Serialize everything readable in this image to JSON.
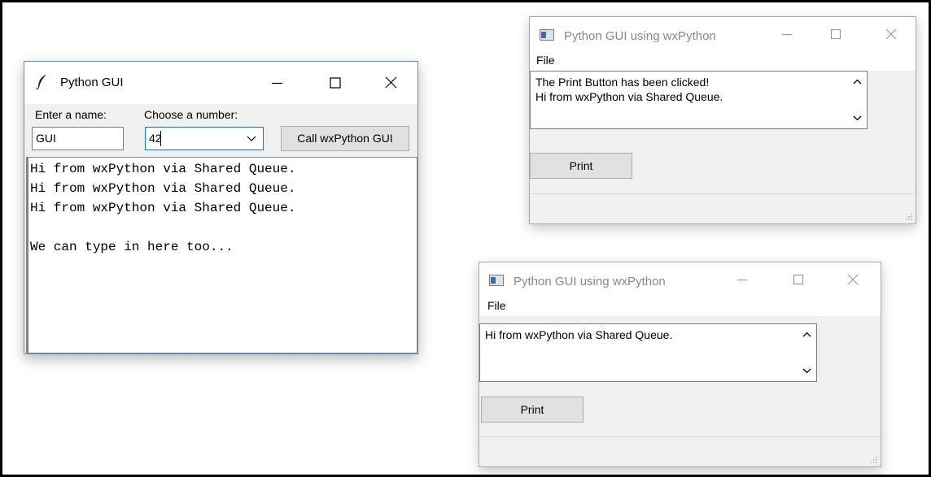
{
  "tk_window": {
    "title": "Python GUI",
    "name_label": "Enter a name:",
    "name_value": "GUI",
    "number_label": "Choose a number:",
    "number_value": "42",
    "button_label": "Call wxPython GUI",
    "text_lines": [
      "Hi from wxPython via Shared Queue.",
      "Hi from wxPython via Shared Queue.",
      "Hi from wxPython via Shared Queue.",
      "",
      "We can type in here too..."
    ],
    "icons": {
      "app": "feather-icon",
      "minimize": "minimize-icon",
      "maximize": "maximize-icon",
      "close": "close-icon"
    }
  },
  "wx_window_top": {
    "title": "Python GUI using wxPython",
    "menu": "File",
    "text_lines": [
      "The Print Button has been clicked!",
      "Hi from wxPython via Shared Queue."
    ],
    "button_label": "Print"
  },
  "wx_window_bottom": {
    "title": "Python GUI using wxPython",
    "menu": "File",
    "text_lines": [
      "Hi from wxPython via Shared Queue."
    ],
    "button_label": "Print"
  },
  "colors": {
    "tk_border": "#5b8ed6",
    "combo_focus": "#0078d7",
    "button_bg": "#e1e1e1",
    "window_bg": "#f0f0f0",
    "wx_title_text": "#888888"
  }
}
